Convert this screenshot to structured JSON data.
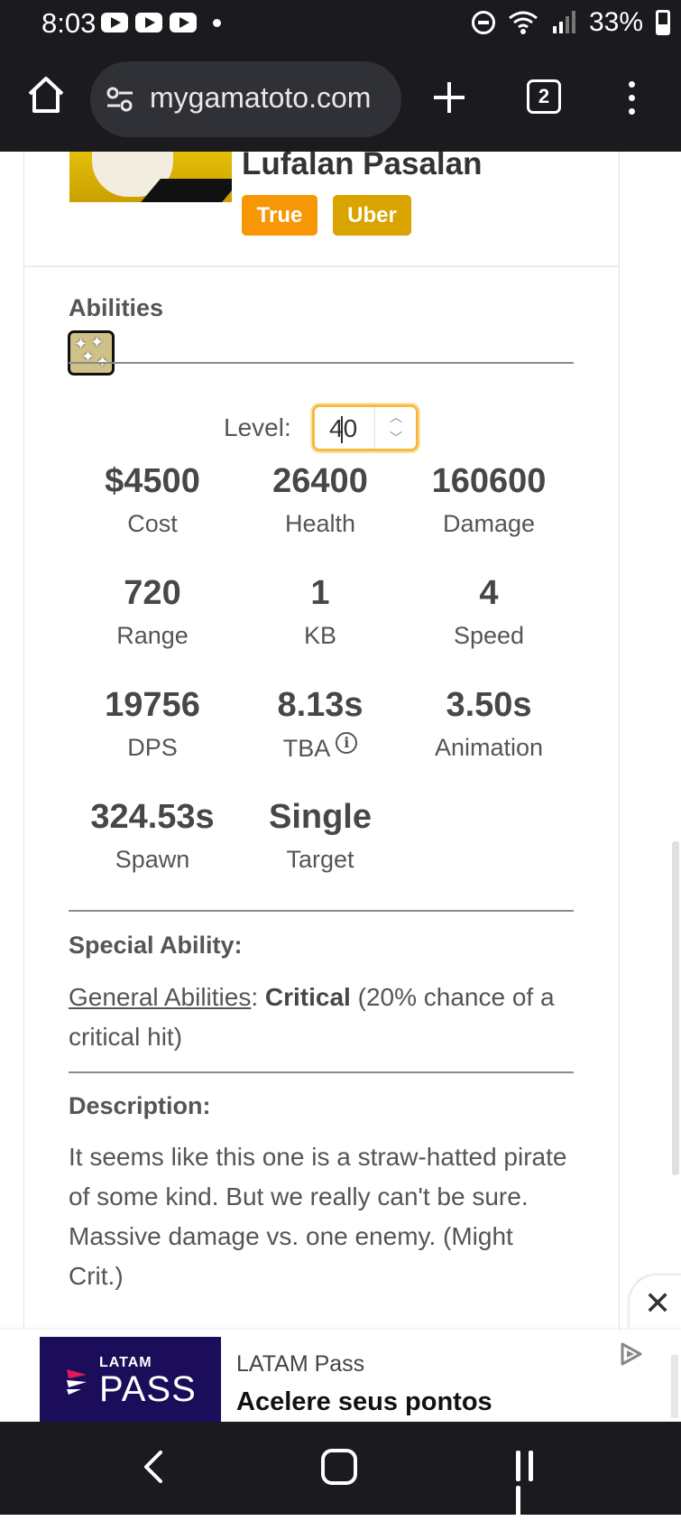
{
  "status_bar": {
    "time": "8:03",
    "battery": "33%",
    "notification_icons": [
      "youtube-icon",
      "youtube-icon",
      "youtube-icon"
    ]
  },
  "browser": {
    "url": "mygamatoto.com",
    "tab_count": "2"
  },
  "unit": {
    "name": "Lufalan Pasalan",
    "badges": {
      "true_label": "True",
      "uber_label": "Uber"
    },
    "abilities_title": "Abilities",
    "level_label": "Level:",
    "level_value": "40",
    "stats": {
      "cost": {
        "value": "$4500",
        "label": "Cost"
      },
      "health": {
        "value": "26400",
        "label": "Health"
      },
      "damage": {
        "value": "160600",
        "label": "Damage"
      },
      "range": {
        "value": "720",
        "label": "Range"
      },
      "kb": {
        "value": "1",
        "label": "KB"
      },
      "speed": {
        "value": "4",
        "label": "Speed"
      },
      "dps": {
        "value": "19756",
        "label": "DPS"
      },
      "tba": {
        "value": "8.13s",
        "label": "TBA"
      },
      "animation": {
        "value": "3.50s",
        "label": "Animation"
      },
      "spawn": {
        "value": "324.53s",
        "label": "Spawn"
      },
      "target": {
        "value": "Single",
        "label": "Target"
      }
    },
    "special_ability": {
      "title": "Special Ability:",
      "link": "General Abilities",
      "separator": ":",
      "name": "Critical",
      "detail": "(20% chance of a critical hit)"
    },
    "description": {
      "title": "Description:",
      "text": "It seems like this one is a straw-hatted pirate of some kind. But we really can't be sure. Massive damage vs. one enemy. (Might Crit.)"
    }
  },
  "ad": {
    "logo_small": "LATAM",
    "logo_big": "PASS",
    "title": "LATAM Pass",
    "subtitle": "Acelere seus pontos",
    "close_symbol": "✕"
  },
  "colors": {
    "true_badge": "#f89706",
    "uber_badge": "#d9a300",
    "input_focus": "#f5b945",
    "ad_brand": "#1b0d5a"
  }
}
